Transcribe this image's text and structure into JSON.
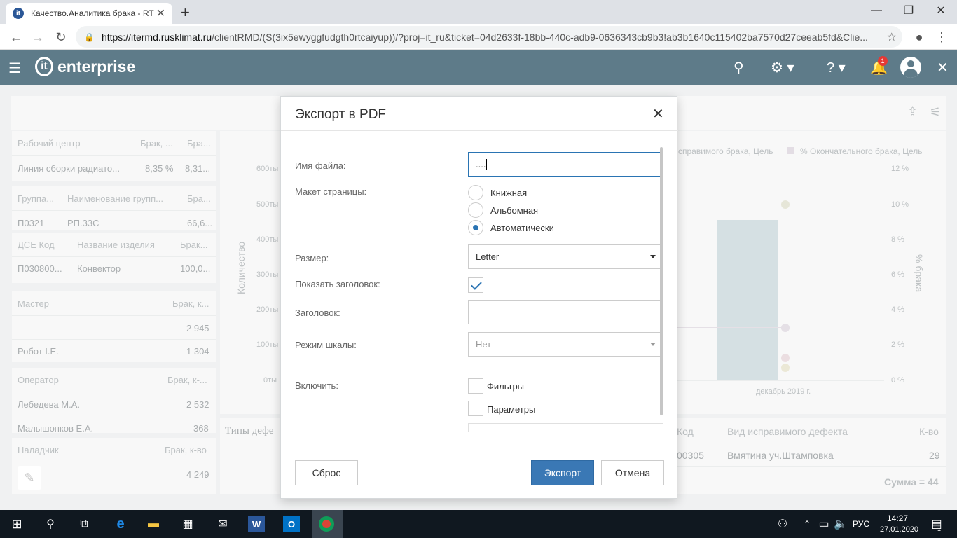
{
  "browser": {
    "tab_title": "Качество.Аналитика брака - RTF",
    "tab_favicon": "it",
    "url_host": "https://itermd.rusklimat.ru",
    "url_path": "/clientRMD/(S(3ix5ewyggfudgth0rtcaiyup))/?proj=it_ru&ticket=04d2633f-18bb-440c-adb9-0636343cb9b3!ab3b1640c115402ba7570d27ceeab5fd&Clie..."
  },
  "app": {
    "logo_mark": "it",
    "logo_text": "enterprise",
    "notification_count": "1"
  },
  "background": {
    "workcenter": {
      "h1": "Рабочий центр",
      "h2": "Брак, ...",
      "h3": "Бра...",
      "r1": "Линия сборки радиато...",
      "r2": "8,35 %",
      "r3": "8,31..."
    },
    "group": {
      "h1": "Группа...",
      "h2": "Наименование групп...",
      "h3": "Бра...",
      "r1": "П0321",
      "r2": "РП.33С",
      "r3": "66,6..."
    },
    "dse": {
      "h1": "ДСЕ Код",
      "h2": "Название изделия",
      "h3": "Брак...",
      "r1": "П030800...",
      "r2": "Конвектор",
      "r3": "100,0..."
    },
    "master": {
      "h1": "Мастер",
      "h2": "Брак, к...",
      "v1": "2 945",
      "r2a": "Робот I.E.",
      "r2b": "1 304"
    },
    "operator": {
      "h1": "Оператор",
      "h2": "Брак, к-...",
      "r1a": "Лебедева М.А.",
      "r1b": "2 532",
      "r2a": "Малышонков Е.А.",
      "r2b": "368"
    },
    "adjuster": {
      "h1": "Наладчик",
      "h2": "Брак, к-во",
      "v1": "4 249"
    },
    "chart": {
      "ylabel_left": "Количество",
      "ylabel_right": "% брака",
      "yticks_left": [
        "600ты",
        "500ты",
        "400ты",
        "300ты",
        "200ты",
        "100ты",
        "0ты"
      ],
      "yticks_right": [
        "12 %",
        "10 %",
        "8 %",
        "6 %",
        "4 %",
        "2 %",
        "0 %"
      ],
      "legend1": "справимого брака, Цель",
      "legend2": "% Окончательного брака, Цель",
      "xtick": "декабрь 2019 г."
    },
    "defects": {
      "title": "Типы дефе",
      "h1": "Код",
      "h2": "Вид исправимого дефекта",
      "h3": "К-во",
      "r1": "00305",
      "r2": "Вмятина уч.Штамповка",
      "r3": "29",
      "sum": "Сумма = 44"
    }
  },
  "modal": {
    "title": "Экспорт в PDF",
    "filename_label": "Имя файла:",
    "filename_value": "....",
    "layout_label": "Макет страницы:",
    "layout_options": [
      "Книжная",
      "Альбомная",
      "Автоматически"
    ],
    "layout_selected": "Автоматически",
    "size_label": "Размер:",
    "size_value": "Letter",
    "show_header_label": "Показать заголовок:",
    "show_header_checked": true,
    "header_label": "Заголовок:",
    "header_value": "",
    "scale_label": "Режим шкалы:",
    "scale_value": "Нет",
    "include_label": "Включить:",
    "include_filters": "Фильтры",
    "include_params": "Параметры",
    "reset_button": "Сброс",
    "export_button": "Экспорт",
    "cancel_button": "Отмена"
  },
  "taskbar": {
    "lang": "РУС",
    "time": "14:27",
    "date": "27.01.2020",
    "notif_count": "1"
  },
  "colors": {
    "header": "#5e7b89",
    "primary": "#3a78b5",
    "bar": "#bfd0d4"
  }
}
